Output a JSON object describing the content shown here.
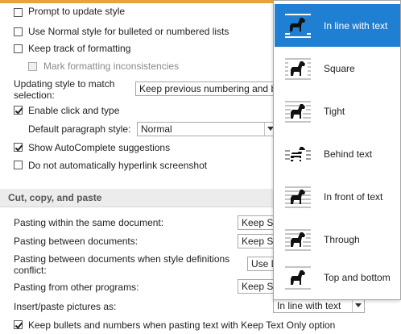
{
  "editing": {
    "prompt_update_style": "Prompt to update style",
    "use_normal_style": "Use Normal style for bulleted or numbered lists",
    "keep_track": "Keep track of formatting",
    "mark_inconsistencies": "Mark formatting inconsistencies",
    "updating_style_label": "Updating style to match selection:",
    "updating_style_value": "Keep previous numbering and b",
    "enable_click_type": "Enable click and type",
    "default_para_label": "Default paragraph style:",
    "default_para_value": "Normal",
    "show_autocomplete": "Show AutoComplete suggestions",
    "no_auto_hyperlink": "Do not automatically hyperlink screenshot"
  },
  "cut_copy_paste": {
    "section_title": "Cut, copy, and paste",
    "within_doc_label": "Pasting within the same document:",
    "within_doc_value": "Keep So",
    "between_docs_label": "Pasting between documents:",
    "between_docs_value": "Keep So",
    "conflict_label": "Pasting between documents when style definitions conflict:",
    "conflict_value": "Use D",
    "other_programs_label": "Pasting from other programs:",
    "other_programs_value": "Keep So",
    "insert_pictures_label": "Insert/paste pictures as:",
    "insert_pictures_value": "In line with text",
    "keep_bullets": "Keep bullets and numbers when pasting text with Keep Text Only option"
  },
  "wrap_gallery": {
    "items": [
      {
        "label": "In line with text",
        "icon": "inline-icon"
      },
      {
        "label": "Square",
        "icon": "square-wrap-icon"
      },
      {
        "label": "Tight",
        "icon": "tight-wrap-icon"
      },
      {
        "label": "Behind text",
        "icon": "behind-text-icon"
      },
      {
        "label": "In front of text",
        "icon": "in-front-of-text-icon"
      },
      {
        "label": "Through",
        "icon": "through-wrap-icon"
      },
      {
        "label": "Top and bottom",
        "icon": "top-bottom-wrap-icon"
      }
    ],
    "selected": "In line with text"
  },
  "colors": {
    "accent": "#1e7fd3",
    "top_strip": "#e8a33a"
  }
}
